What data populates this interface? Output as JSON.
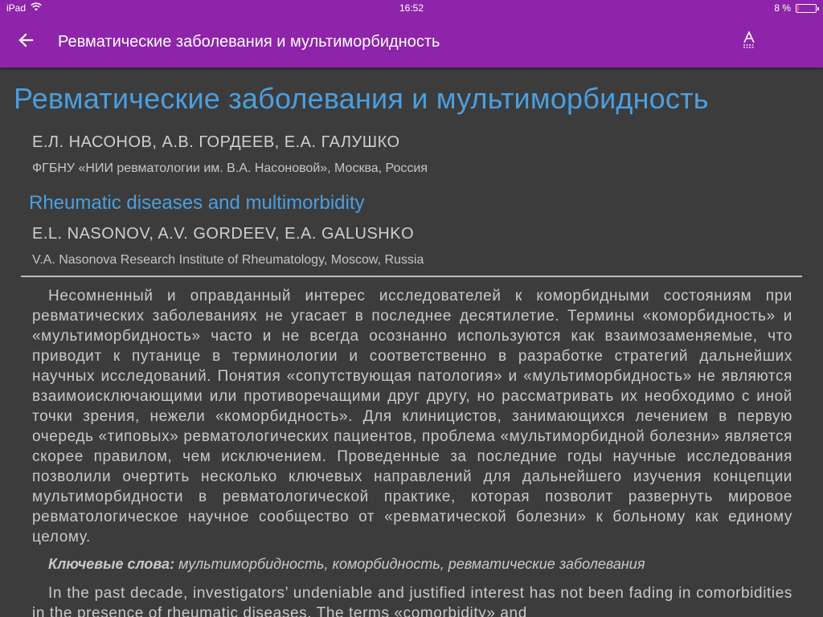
{
  "status_bar": {
    "device": "iPad",
    "time": "16:52",
    "battery_text": "8 %",
    "battery_level": 0.08
  },
  "app_bar": {
    "title": "Ревматические заболевания и мультиморбидность",
    "back_icon": "arrow-left-icon",
    "font_icon": "text-format-icon",
    "night_icon": "moon-icon",
    "color": "#8e24aa"
  },
  "article": {
    "title_ru": "Ревматические заболевания и мультиморбидность",
    "authors_ru": "Е.Л. НАСОНОВ, А.В. ГОРДЕЕВ, Е.А. ГАЛУШКО",
    "affiliation_ru": "ФГБНУ «НИИ ревматологии им. В.А. Насоновой», Москва, Россия",
    "title_en": "Rheumatic diseases and multimorbidity",
    "authors_en": "E.L. NASONOV, A.V. GORDEEV, E.A. GALUSHKO",
    "affiliation_en": "V.A. Nasonova Research Institute of Rheumatology, Moscow, Russia",
    "abstract_ru": "Несомненный и оправданный интерес исследователей к коморбидными состояниям при ревматических заболеваниях не угасает в последнее десятилетие. Термины «коморбид­ность» и «мультиморбидность» часто и не всегда осознанно используются как взаимозаме­няемые, что приводит к путанице в терминологии и соответственно в разработке страте­гий дальнейших научных исследований. Понятия «сопутствующая патология» и «мульти­морбидность» не являются взаимоисключающими или противоречащими друг другу, но рассматривать их необходимо с иной точки зрения, нежели «коморбидность». Для кли­ницистов, занимающихся лечением в первую очередь «типовых» ревматологических паци­ентов, проблема «мультиморбидной болезни» является скорее правилом, чем исключени­ем. Проведенные за последние годы научные исследования позволили очертить несколь­ко ключевых направлений для дальнейшего изучения концепции мультиморбидности в ревматологической практике, которая позволит развернуть мировое ревматологическое научное сообщество от «ревматической болезни» к больному как единому целому.",
    "keywords_label": "Ключевые слова:",
    "keywords": "мультиморбидность, коморбидность, ревматические заболевания",
    "abstract_en": "In the past decade, investigators’ undeniable and justified interest has not been fading in comorbidities in the presence of rheumatic diseases. The terms «comorbidity» and"
  },
  "colors": {
    "accent": "#4a9fe0",
    "background": "#3c3c3c",
    "text": "#c9c9c9"
  }
}
